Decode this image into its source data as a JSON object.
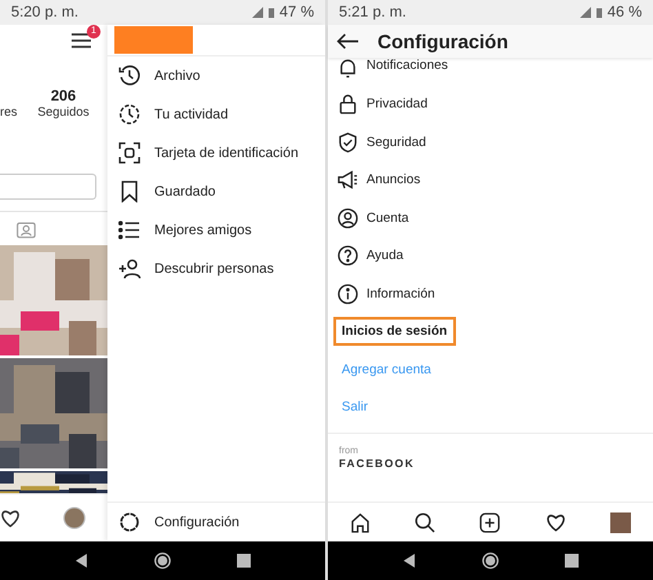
{
  "left_screen": {
    "status_bar": {
      "time": "5:20 p. m.",
      "battery": "47 %"
    },
    "profile": {
      "menu_badge": "1",
      "stats": [
        {
          "label": "res"
        },
        {
          "value": "206",
          "label": "Seguidos"
        }
      ]
    },
    "drawer": {
      "items": [
        {
          "label": "Archivo"
        },
        {
          "label": "Tu actividad"
        },
        {
          "label": "Tarjeta de identificación"
        },
        {
          "label": "Guardado"
        },
        {
          "label": "Mejores amigos"
        },
        {
          "label": "Descubrir personas"
        }
      ],
      "footer": "Configuración"
    }
  },
  "right_screen": {
    "status_bar": {
      "time": "5:21 p. m.",
      "battery": "46 %"
    },
    "title": "Configuración",
    "items": [
      {
        "label": "Notificaciones"
      },
      {
        "label": "Privacidad"
      },
      {
        "label": "Seguridad"
      },
      {
        "label": "Anuncios"
      },
      {
        "label": "Cuenta"
      },
      {
        "label": "Ayuda"
      },
      {
        "label": "Información"
      }
    ],
    "plain_items": [
      {
        "label": "Inicios de sesión",
        "kind": "plain",
        "highlighted": true
      },
      {
        "label": "Agregar cuenta",
        "kind": "link",
        "highlighted": false
      },
      {
        "label": "Salir",
        "kind": "link",
        "highlighted": false
      }
    ],
    "from": "from",
    "brand": "FACEBOOK"
  }
}
